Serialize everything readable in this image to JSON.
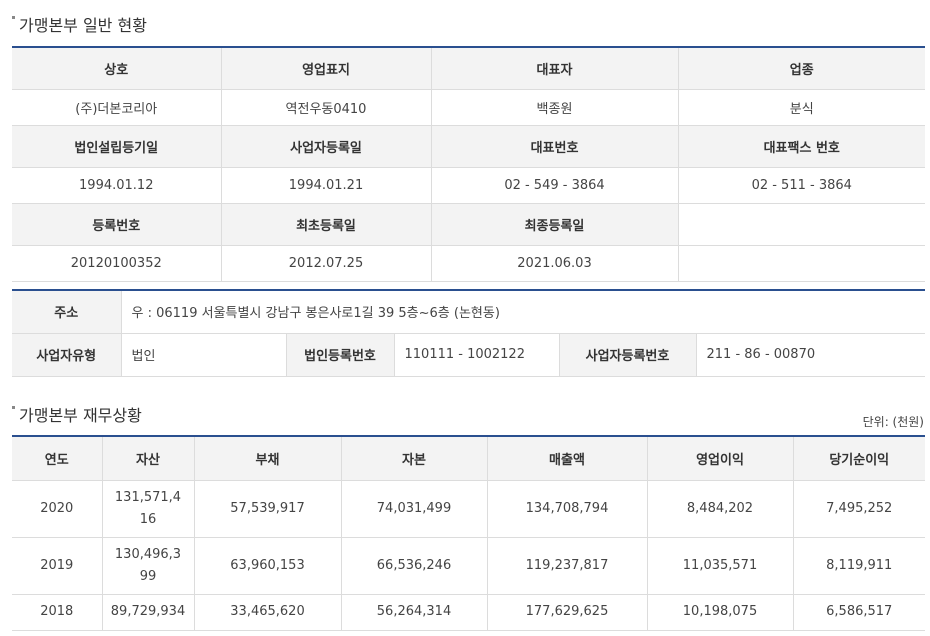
{
  "general": {
    "title": "가맹본부 일반 현황",
    "headers1": [
      "상호",
      "영업표지",
      "대표자",
      "업종"
    ],
    "values1": [
      "(주)더본코리아",
      "역전우동0410",
      "백종원",
      "분식"
    ],
    "headers2": [
      "법인설립등기일",
      "사업자등록일",
      "대표번호",
      "대표팩스 번호"
    ],
    "values2": [
      "1994.01.12",
      "1994.01.21",
      "02 - 549 - 3864",
      "02 - 511 - 3864"
    ],
    "headers3": [
      "등록번호",
      "최초등록일",
      "최종등록일",
      ""
    ],
    "values3": [
      "20120100352",
      "2012.07.25",
      "2021.06.03",
      ""
    ]
  },
  "address": {
    "address_label": "주소",
    "address_value": "우 : 06119 서울특별시 강남구 봉은사로1길 39 5층~6층 (논현동)",
    "biz_type_label": "사업자유형",
    "biz_type_value": "법인",
    "corp_reg_label": "법인등록번호",
    "corp_reg_value": "110111 - 1002122",
    "biz_reg_label": "사업자등록번호",
    "biz_reg_value": "211 - 86 - 00870"
  },
  "finance": {
    "title": "가맹본부 재무상황",
    "unit": "단위: (천원)",
    "headers": [
      "연도",
      "자산",
      "부채",
      "자본",
      "매출액",
      "영업이익",
      "당기순이익"
    ],
    "rows": [
      [
        "2020",
        "131,571,416",
        "57,539,917",
        "74,031,499",
        "134,708,794",
        "8,484,202",
        "7,495,252"
      ],
      [
        "2019",
        "130,496,399",
        "63,960,153",
        "66,536,246",
        "119,237,817",
        "11,035,571",
        "8,119,911"
      ],
      [
        "2018",
        "89,729,934",
        "33,465,620",
        "56,264,314",
        "177,629,625",
        "10,198,075",
        "6,586,517"
      ]
    ]
  }
}
